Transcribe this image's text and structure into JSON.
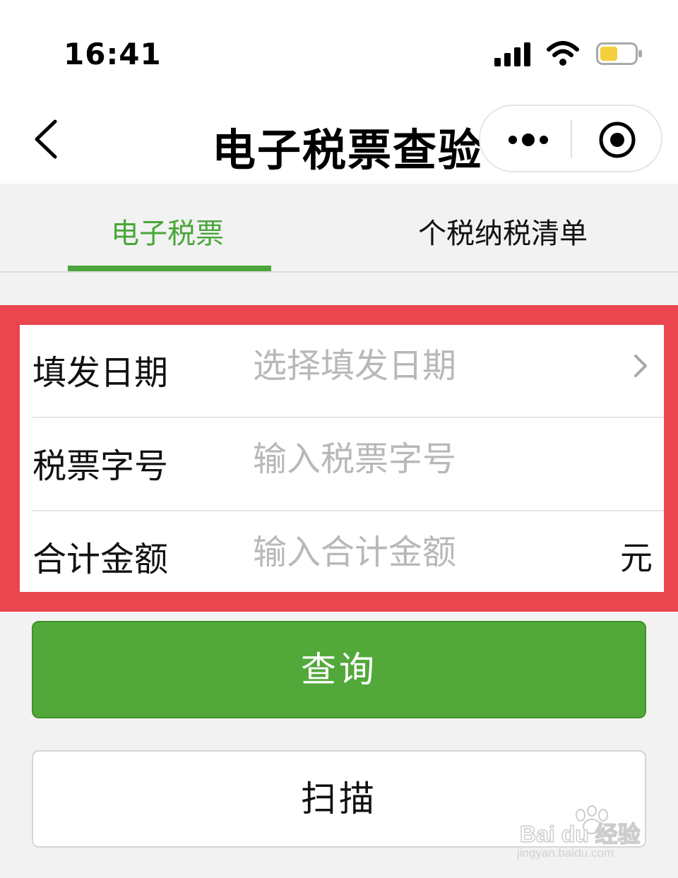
{
  "status_bar": {
    "time": "16:41",
    "icons": [
      "signal-icon",
      "wifi-icon",
      "battery-icon"
    ],
    "battery_color": "#f5d03c"
  },
  "nav": {
    "title": "电子税票查验",
    "icons": [
      "back-icon",
      "more-icon",
      "close-miniprogram-icon"
    ]
  },
  "tabs": [
    {
      "label": "电子税票",
      "active": true
    },
    {
      "label": "个税纳税清单",
      "active": false
    }
  ],
  "form": {
    "date": {
      "label": "填发日期",
      "placeholder": "选择填发日期"
    },
    "number": {
      "label": "税票字号",
      "placeholder": "输入税票字号"
    },
    "amount": {
      "label": "合计金额",
      "placeholder": "输入合计金额",
      "unit": "元"
    }
  },
  "buttons": {
    "query": "查询",
    "scan": "扫描"
  },
  "watermark": {
    "logo": "Bai du 经验",
    "url": "jingyan.baidu.com"
  },
  "colors": {
    "accent_green": "#4aa63a",
    "button_green": "#52a93a",
    "highlight_red": "#e9464f"
  }
}
